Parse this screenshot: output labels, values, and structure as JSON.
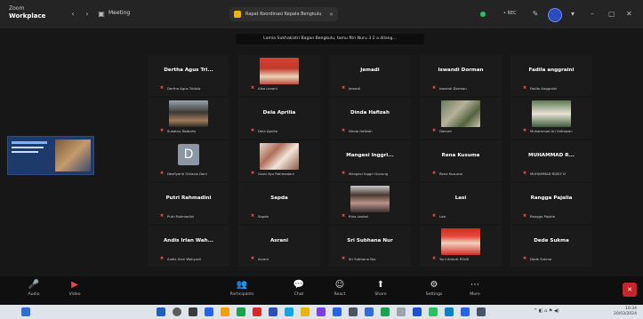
{
  "app": {
    "brand_top": "Zoom",
    "brand_name": "Workplace",
    "meeting_menu": "Meeting",
    "window_title": "Rapat Koordinasi Kepala Bengkulu",
    "rec_tag": "• REC"
  },
  "caption": "Lamia Sukhakistri Bagan Bengkulu, tamu fitri Nuru 3 2 a dilang...",
  "colors": {
    "background": "#171717",
    "topbar": "#242424",
    "toolbar": "#0f0f0f",
    "muted_red": "#e5484d",
    "accent_blue": "#2c4bbd"
  },
  "participants": [
    {
      "name": "Dertha Agus Tri...",
      "label": "Dertha Agus Tridola"
    },
    {
      "name": "",
      "label": "Aiko Levani",
      "photo": true
    },
    {
      "name": "Jemadi",
      "label": "Jemadi"
    },
    {
      "name": "Iswandi Dorman",
      "label": "Iswandi Dorman"
    },
    {
      "name": "Fadila anggraini",
      "label": "Fadila Anggraini"
    },
    {
      "name": "",
      "label": "Sukatno Naibaho",
      "photo": true
    },
    {
      "name": "Dela Aprilia",
      "label": "Dela Aprilia"
    },
    {
      "name": "Dinda Hafizah",
      "label": "Dinda Hafizah"
    },
    {
      "name": "",
      "label": "Daerah",
      "photo": true
    },
    {
      "name": "",
      "label": "Muhammad Ari Setiawan",
      "photo": true
    },
    {
      "name": "",
      "label": "Desfiyanti Octavia Doni",
      "avatar": "D"
    },
    {
      "name": "",
      "label": "Gusti Ayu Rahmadani",
      "photo": true
    },
    {
      "name": "Mangesi Inggri...",
      "label": "Mangesi Inggri Gunung"
    },
    {
      "name": "Rena Kusuma",
      "label": "Rena Kusuma"
    },
    {
      "name": "MUHAMMAD R...",
      "label": "MUHAMMAD RIZKY D"
    },
    {
      "name": "Putri Rahmadini",
      "label": "Putri Rahmadini"
    },
    {
      "name": "Sapda",
      "label": "Sapda"
    },
    {
      "name": "",
      "label": "Rina Lestari",
      "photo": true
    },
    {
      "name": "Lasi",
      "label": "Lasi"
    },
    {
      "name": "Rangga Pajalia",
      "label": "Rangga Pajalia"
    },
    {
      "name": "Andis Irlan Wah...",
      "label": "Andis Irlan Wahyudi"
    },
    {
      "name": "Asrani",
      "label": "Asrani"
    },
    {
      "name": "Sri Subhana Nur",
      "label": "Sri Subhana Nur"
    },
    {
      "name": "",
      "label": "Yuni Arianti RSUD",
      "photo": true
    },
    {
      "name": "Dede Sukma",
      "label": "Dede Sukma"
    }
  ],
  "toolbar": {
    "items": [
      {
        "label": "Audio",
        "icon": "microphone-muted-icon",
        "glyph": "🎤"
      },
      {
        "label": "Video",
        "icon": "video-off-icon",
        "glyph": "▶"
      },
      {
        "label": "Participants",
        "icon": "participants-icon",
        "glyph": "👥"
      },
      {
        "label": "Chat",
        "icon": "chat-icon",
        "glyph": "💬"
      },
      {
        "label": "React",
        "icon": "react-icon",
        "glyph": "☺"
      },
      {
        "label": "Share",
        "icon": "share-icon",
        "glyph": "⬆"
      },
      {
        "label": "Settings",
        "icon": "settings-icon",
        "glyph": "⚙"
      },
      {
        "label": "More",
        "icon": "more-icon",
        "glyph": "⋯"
      }
    ],
    "leave": "✕"
  },
  "taskbar": {
    "tray_text": "^ ◧ ⌂ ⚑ ◀)",
    "time": "10:34",
    "date": "20/03/2024"
  }
}
